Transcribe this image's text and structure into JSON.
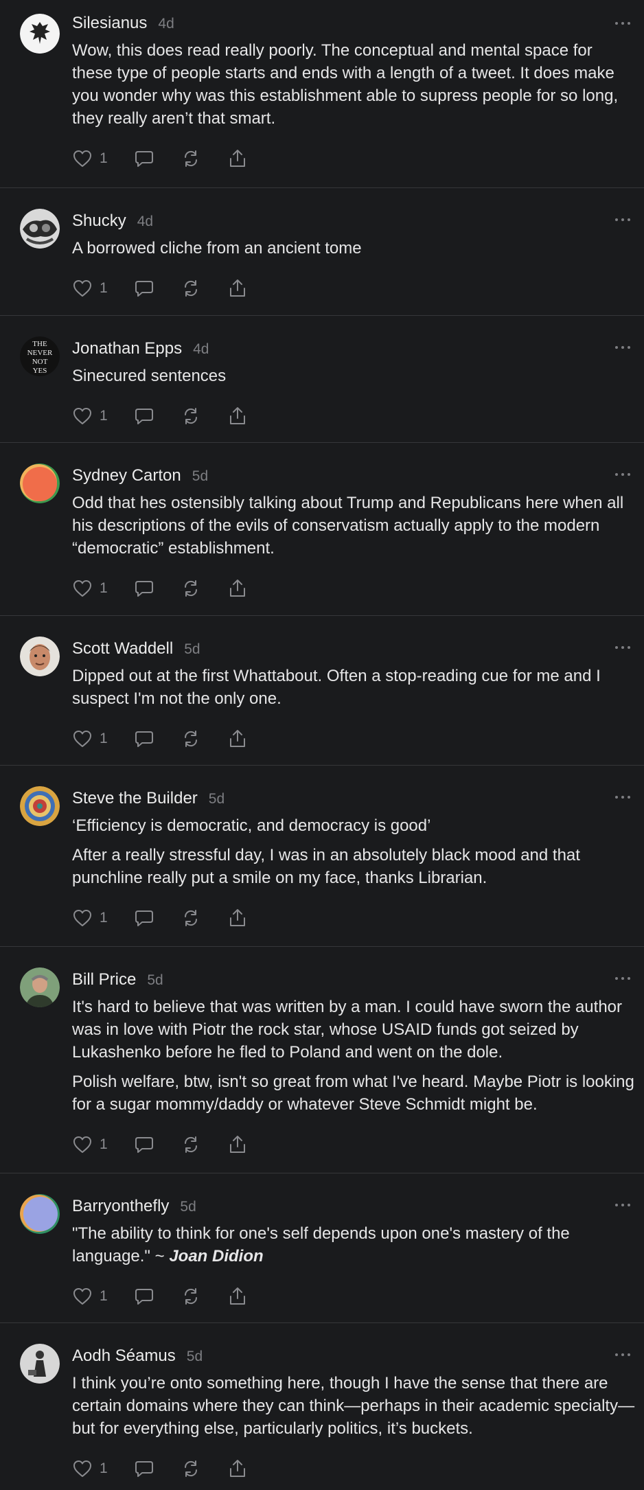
{
  "comments": [
    {
      "name": "Silesianus",
      "time": "4d",
      "avatar": "eagle-crest-avatar",
      "paragraphs": [
        "Wow, this does read really poorly. The conceptual and mental space for these type of people starts and ends with a length of a tweet. It does make you wonder why was this establishment able to supress people for so long, they really aren’t that smart."
      ],
      "likes": "1"
    },
    {
      "name": "Shucky",
      "time": "4d",
      "avatar": "photo-avatar",
      "paragraphs": [
        "A borrowed cliche from an ancient tome"
      ],
      "likes": "1"
    },
    {
      "name": "Jonathan Epps",
      "time": "4d",
      "avatar": "text-logo-avatar",
      "avatar_text": [
        "THE",
        "NEVER",
        "NOT",
        "YES"
      ],
      "paragraphs": [
        "Sinecured sentences"
      ],
      "likes": "1"
    },
    {
      "name": "Sydney Carton",
      "time": "5d",
      "avatar": "orange-gradient-avatar",
      "paragraphs": [
        "Odd that hes ostensibly talking about Trump and Republicans here when all his descriptions of the evils of conservatism actually apply to the modern “democratic” establishment."
      ],
      "likes": "1"
    },
    {
      "name": "Scott Waddell",
      "time": "5d",
      "avatar": "face-photo-avatar",
      "paragraphs": [
        "Dipped out at the first Whattabout. Often a stop-reading cue for me and I suspect I'm not the only one."
      ],
      "likes": "1"
    },
    {
      "name": "Steve the Builder",
      "time": "5d",
      "avatar": "mandala-avatar",
      "paragraphs": [
        "‘Efficiency is democratic, and democracy is good’",
        "After a really stressful day, I was in an absolutely black mood and that punchline really put a smile on my face, thanks Librarian."
      ],
      "likes": "1"
    },
    {
      "name": "Bill Price",
      "time": "5d",
      "avatar": "face-photo-avatar",
      "paragraphs": [
        "It's hard to believe that was written by a man. I could have sworn the author was in love with Piotr the rock star, whose USAID funds got seized by Lukashenko before he fled to Poland and went on the dole.",
        "Polish welfare, btw, isn't so great from what I've heard. Maybe Piotr is looking for a sugar mommy/daddy or whatever Steve Schmidt might be."
      ],
      "likes": "1"
    },
    {
      "name": "Barryonthefly",
      "time": "5d",
      "avatar": "purple-gradient-avatar",
      "paragraphs": [
        "\"The ability to think for one's self depends upon one's mastery of the language.\" ~ "
      ],
      "quote_author": "Joan Didion",
      "likes": "1"
    },
    {
      "name": "Aodh Séamus",
      "time": "5d",
      "avatar": "figure-photo-avatar",
      "paragraphs": [
        "I think you’re onto something here, though I have the sense that there are certain domains where they can think—perhaps in their academic specialty—but for everything else, particularly politics, it’s buckets."
      ],
      "likes": "1"
    }
  ],
  "icons": {
    "like": "heart-icon",
    "reply": "comment-bubble-icon",
    "restack": "restack-icon",
    "share": "share-icon",
    "more": "ellipsis-icon"
  }
}
